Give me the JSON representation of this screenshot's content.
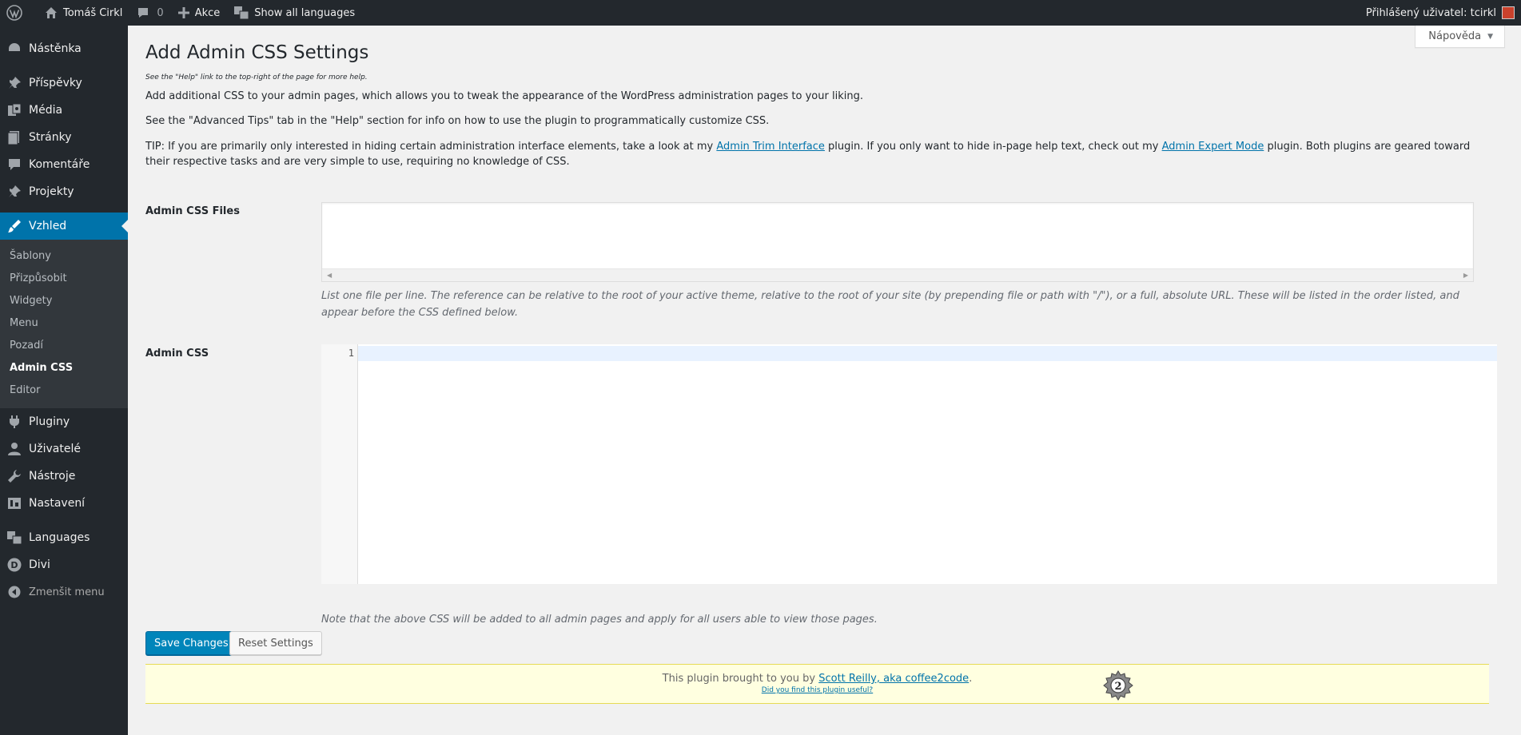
{
  "adminbar": {
    "site_name": "Tomáš Cirkl",
    "comments_count": "0",
    "new_label": "Akce",
    "languages_label": "Show all languages",
    "user_label": "Přihlášený uživatel: tcirkl"
  },
  "sidebar": {
    "items": [
      {
        "label": "Nástěnka",
        "icon": "dashboard-icon"
      },
      {
        "label": "Příspěvky",
        "icon": "pin-icon"
      },
      {
        "label": "Média",
        "icon": "media-icon"
      },
      {
        "label": "Stránky",
        "icon": "pages-icon"
      },
      {
        "label": "Komentáře",
        "icon": "comment-icon"
      },
      {
        "label": "Projekty",
        "icon": "pin-icon"
      },
      {
        "label": "Vzhled",
        "icon": "appearance-icon"
      },
      {
        "label": "Pluginy",
        "icon": "plugin-icon"
      },
      {
        "label": "Uživatelé",
        "icon": "user-icon"
      },
      {
        "label": "Nástroje",
        "icon": "tools-icon"
      },
      {
        "label": "Nastavení",
        "icon": "settings-icon"
      },
      {
        "label": "Languages",
        "icon": "translate-icon"
      },
      {
        "label": "Divi",
        "icon": "divi-icon"
      }
    ],
    "submenu": [
      "Šablony",
      "Přizpůsobit",
      "Widgety",
      "Menu",
      "Pozadí",
      "Admin CSS",
      "Editor"
    ],
    "collapse_label": "Zmenšit menu"
  },
  "help_tab": {
    "label": "Nápověda"
  },
  "main": {
    "title": "Add Admin CSS Settings",
    "help_note": "See the \"Help\" link to the top-right of the page for more help.",
    "intro": "Add additional CSS to your admin pages, which allows you to tweak the appearance of the WordPress administration pages to your liking.",
    "advanced": "See the \"Advanced Tips\" tab in the \"Help\" section for info on how to use the plugin to programmatically customize CSS.",
    "tip": {
      "part1": "TIP: If you are primarily only interested in hiding certain administration interface elements, take a look at my ",
      "link1": "Admin Trim Interface",
      "part2": " plugin. If you only want to hide in-page help text, check out my ",
      "link2": "Admin Expert Mode",
      "part3": " plugin. Both plugins are geared toward their respective tasks and are very simple to use, requiring no knowledge of CSS."
    },
    "files_label": "Admin CSS Files",
    "files_desc": "List one file per line. The reference can be relative to the root of your active theme, relative to the root of your site (by prepending file or path with \"/\"), or a full, absolute URL. These will be listed in the order listed, and appear before the CSS defined below.",
    "css_label": "Admin CSS",
    "css_line_number": "1",
    "css_desc": "Note that the above CSS will be added to all admin pages and apply for all users able to view those pages.",
    "save_label": "Save Changes",
    "reset_label": "Reset Settings"
  },
  "footer": {
    "text": "This plugin brought to you by ",
    "author_link": "Scott Reilly, aka coffee2code",
    "period": ".",
    "useful_link": "Did you find this plugin useful?"
  }
}
